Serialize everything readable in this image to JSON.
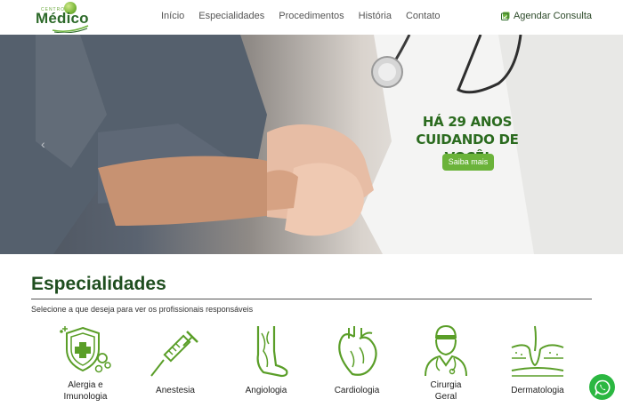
{
  "header": {
    "logo": {
      "small": "CENTRO",
      "main": "Médico"
    },
    "nav": [
      {
        "label": "Início"
      },
      {
        "label": "Especialidades"
      },
      {
        "label": "Procedimentos"
      },
      {
        "label": "História"
      },
      {
        "label": "Contato"
      }
    ],
    "cta_label": "Agendar Consulta"
  },
  "hero": {
    "title_line1": "HÁ 29 ANOS",
    "title_line2": "CUIDANDO DE VOCÊ!",
    "button_label": "Saiba mais"
  },
  "specialties": {
    "title": "Especialidades",
    "subtitle": "Selecione a que deseja para ver os profissionais responsáveis",
    "items": [
      {
        "label_line1": "Alergia e",
        "label_line2": "Imunologia",
        "icon": "allergy-shield-icon"
      },
      {
        "label_line1": "Anestesia",
        "label_line2": "",
        "icon": "syringe-icon"
      },
      {
        "label_line1": "Angiologia",
        "label_line2": "",
        "icon": "leg-veins-icon"
      },
      {
        "label_line1": "Cardiologia",
        "label_line2": "",
        "icon": "heart-icon"
      },
      {
        "label_line1": "Cirurgia",
        "label_line2": "Geral",
        "icon": "surgeon-icon"
      },
      {
        "label_line1": "Dermatologia",
        "label_line2": "",
        "icon": "skin-layers-icon"
      }
    ]
  },
  "colors": {
    "brand_green": "#2d6a2a",
    "accent_green": "#6bb33a",
    "icon_green": "#5a9e28",
    "whatsapp": "#2bb741"
  }
}
